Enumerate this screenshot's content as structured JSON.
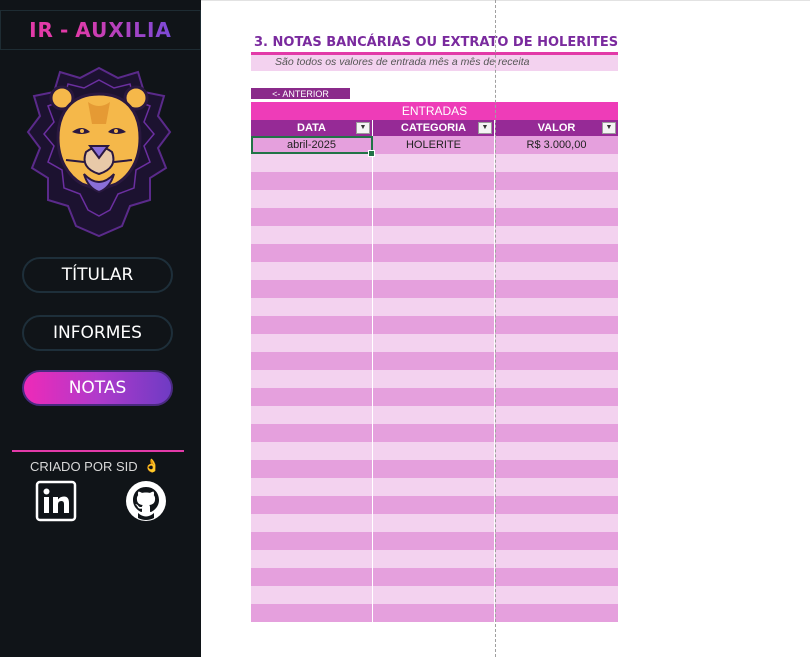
{
  "sidebar": {
    "brand": {
      "part1": "IR",
      "separator": "-",
      "part2": "AUXILIA"
    },
    "logo_icon": "lion-logo-icon",
    "nav": [
      {
        "label": "TÍTULAR",
        "active": false
      },
      {
        "label": "INFORMES",
        "active": false
      },
      {
        "label": "NOTAS",
        "active": true
      }
    ],
    "credit": {
      "text": "CRIADO POR SID",
      "emoji_icon": "ok-hand-icon"
    },
    "social": [
      {
        "name": "linkedin-icon"
      },
      {
        "name": "github-icon"
      }
    ]
  },
  "main": {
    "title": "3. NOTAS BANCÁRIAS OU EXTRATO DE HOLERITES",
    "subtitle": "São todos os valores de entrada mês a mês de receita",
    "prev_button": "<- ANTERIOR",
    "table": {
      "group_header": "ENTRADAS",
      "columns": [
        "DATA",
        "CATEGORIA",
        "VALOR"
      ],
      "rows": [
        [
          "abril-2025",
          "HOLERITE",
          "R$ 3.000,00"
        ]
      ]
    }
  },
  "colors": {
    "sidebar_bg": "#101418",
    "accent": "#e23aa8",
    "title": "#7a2a9e",
    "header_dark": "#962a96",
    "header_pink": "#ee3cb8",
    "row_odd": "#e5a0dd",
    "row_even": "#f3d2ef"
  }
}
